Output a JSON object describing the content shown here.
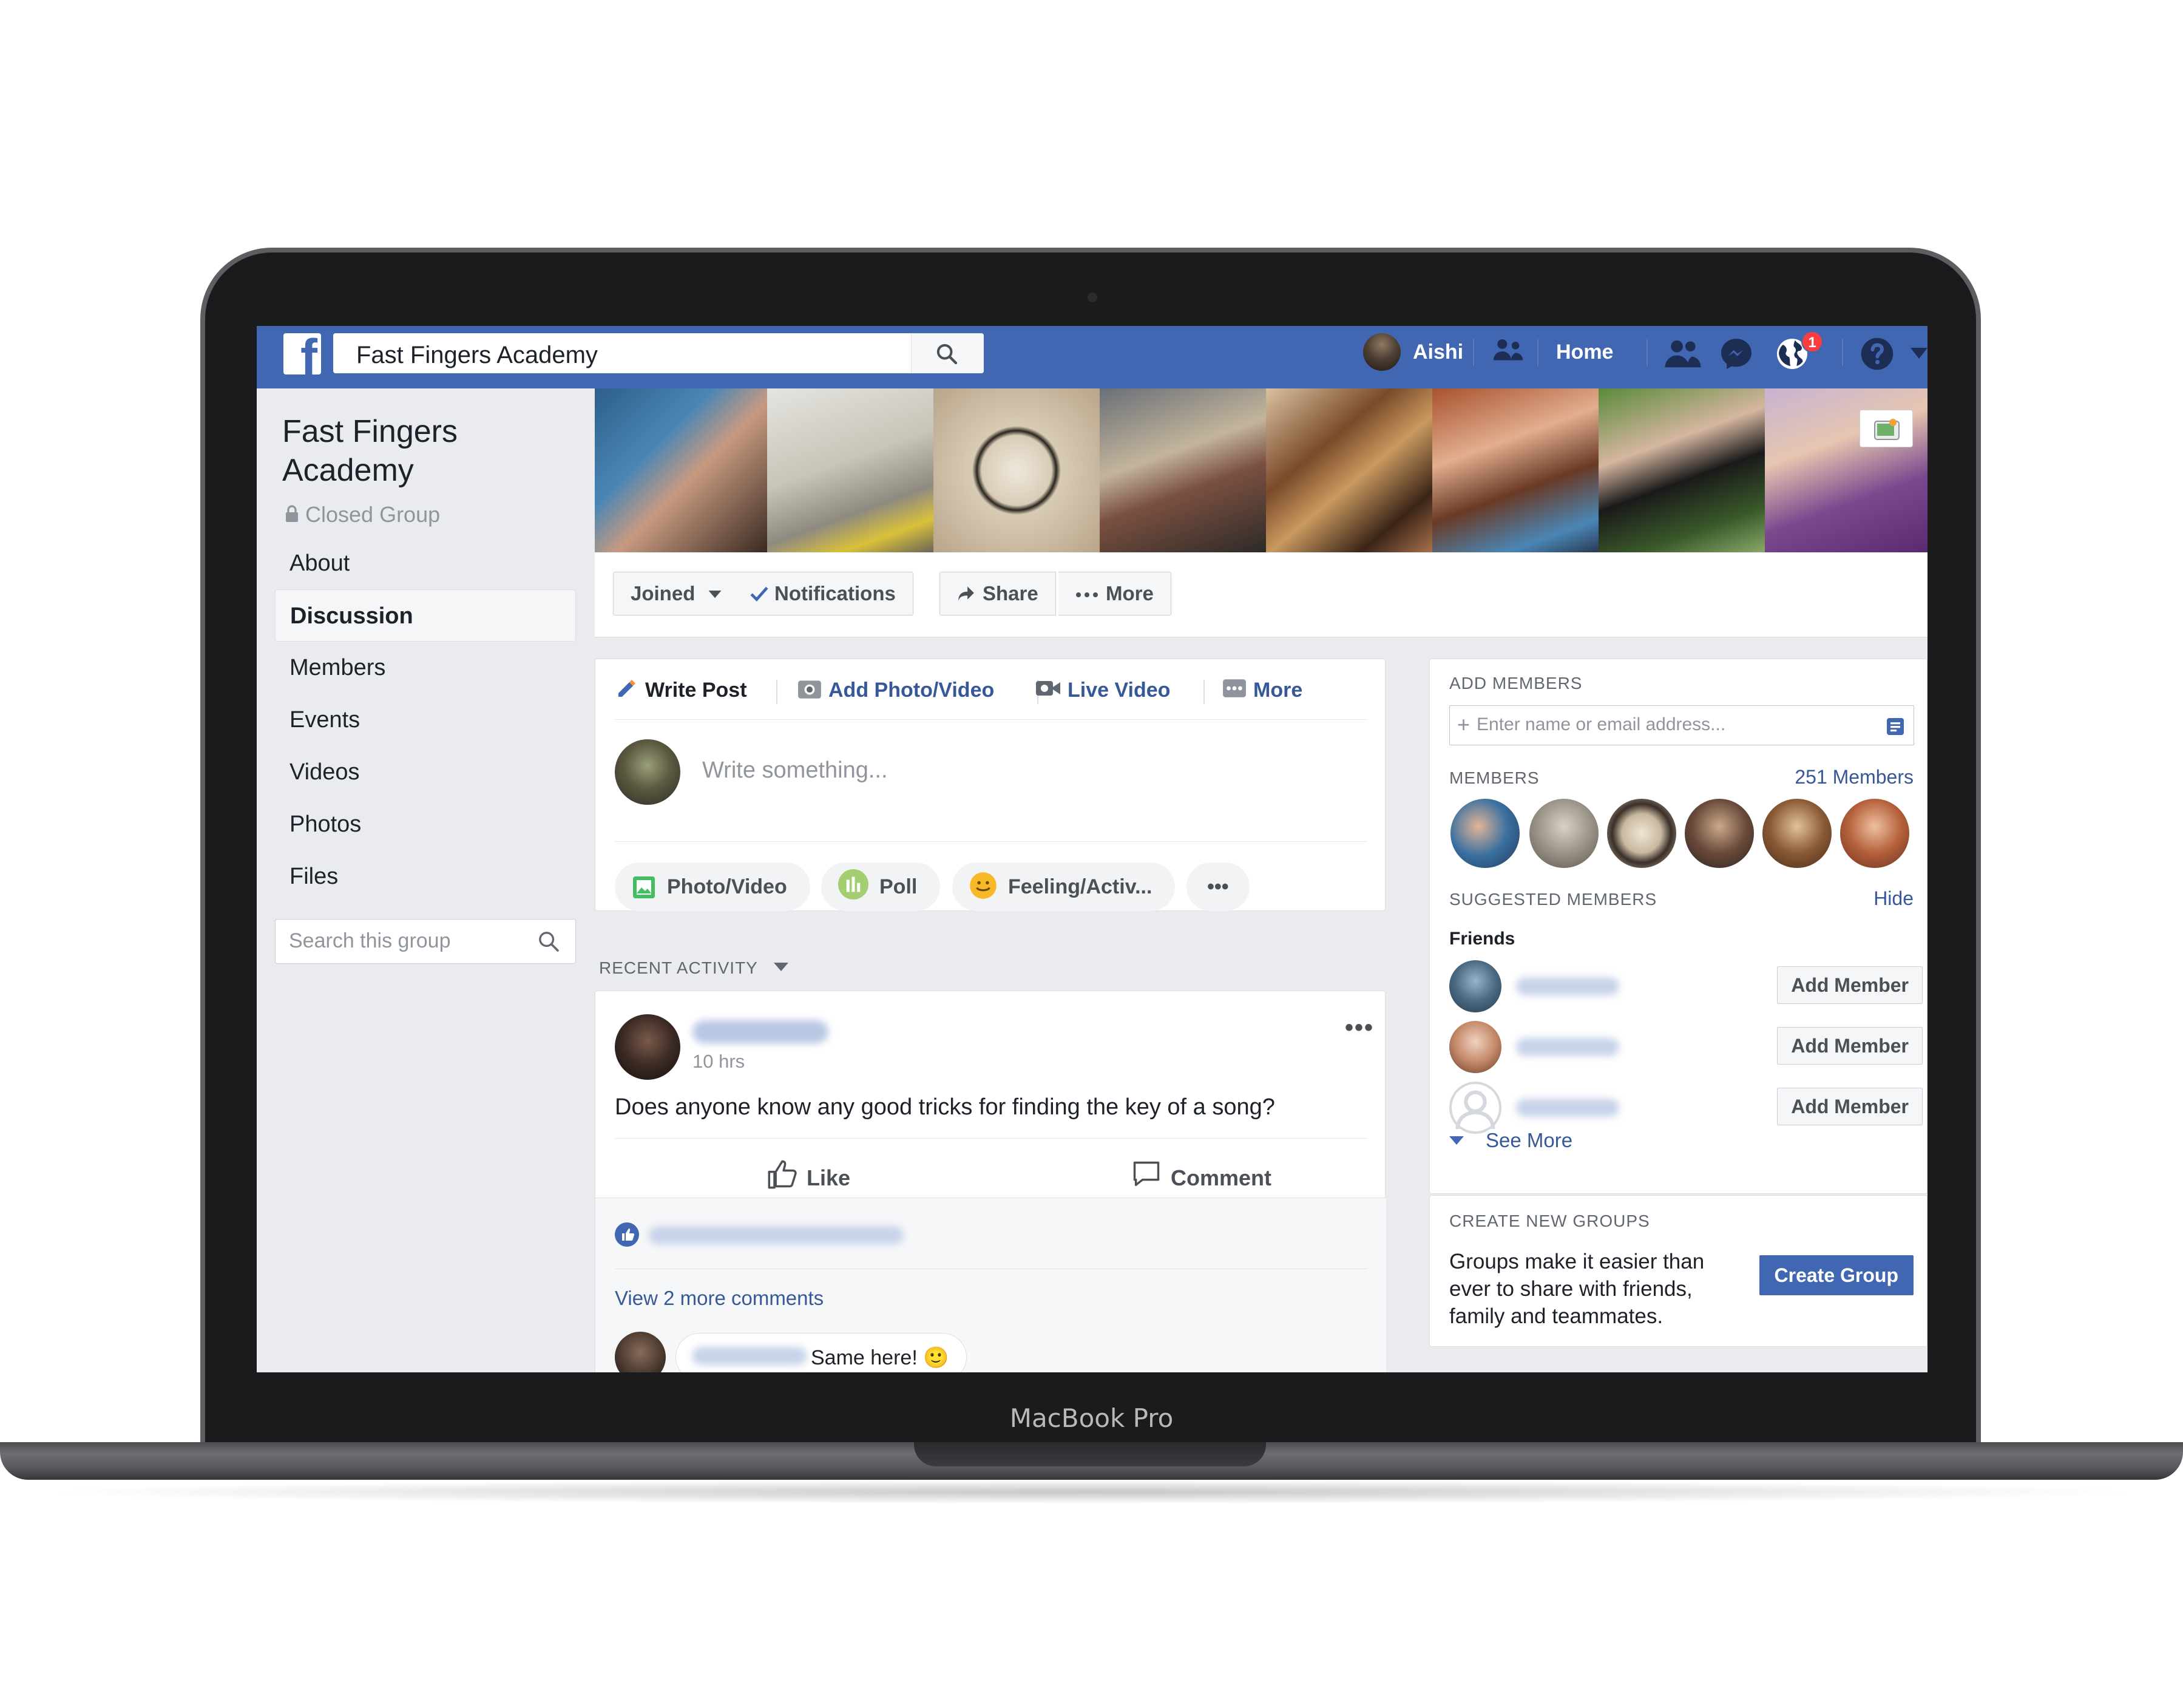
{
  "device": {
    "label": "MacBook Pro"
  },
  "topbar": {
    "search_value": "Fast Fingers Academy",
    "user_name": "Aishi",
    "home_label": "Home",
    "notification_count": "1",
    "brand_color": "#4267b2"
  },
  "group": {
    "name": "Fast Fingers Academy",
    "privacy": "Closed Group"
  },
  "leftnav": {
    "items": [
      "About",
      "Discussion",
      "Members",
      "Events",
      "Videos",
      "Photos",
      "Files"
    ],
    "active": "Discussion",
    "search_placeholder": "Search this group"
  },
  "actions": {
    "joined": "Joined",
    "notifications": "Notifications",
    "share": "Share",
    "more": "More"
  },
  "composer": {
    "tabs": [
      "Write Post",
      "Add Photo/Video",
      "Live Video",
      "More"
    ],
    "placeholder": "Write something...",
    "pills": [
      "Photo/Video",
      "Poll",
      "Feeling/Activ...",
      "•••"
    ]
  },
  "feed": {
    "section_label": "RECENT ACTIVITY",
    "post": {
      "time": "10 hrs",
      "text": "Does anyone know any good tricks for finding the key of a song?",
      "like_label": "Like",
      "comment_label": "Comment",
      "view_more": "View 2 more comments",
      "comment_text": "Same here! 🙂"
    }
  },
  "right": {
    "add_members_title": "ADD MEMBERS",
    "add_members_placeholder": "Enter name or email address...",
    "members_title": "MEMBERS",
    "members_count": "251 Members",
    "suggested_title": "SUGGESTED MEMBERS",
    "hide_label": "Hide",
    "friends_label": "Friends",
    "add_member_label": "Add Member",
    "see_more": "See More",
    "create_title": "CREATE NEW GROUPS",
    "create_text": "Groups make it easier than ever to share with friends, family and teammates.",
    "create_button": "Create Group"
  },
  "icons": [
    "facebook-logo-icon",
    "search-icon",
    "friends-icon",
    "messenger-icon",
    "globe-icon",
    "help-icon",
    "lock-icon",
    "pencil-icon",
    "camera-icon",
    "video-icon",
    "like-icon",
    "comment-icon"
  ]
}
